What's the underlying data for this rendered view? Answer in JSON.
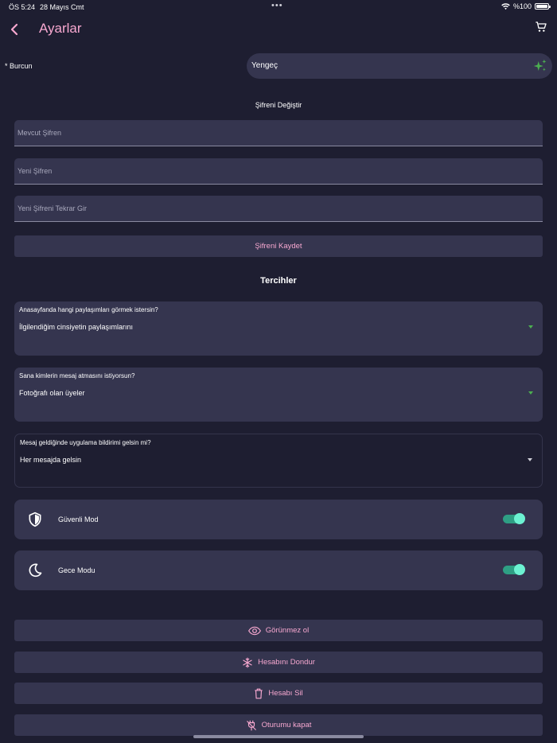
{
  "status_bar": {
    "time": "ÖS 5:24",
    "date": "28 Mayıs Cmt",
    "dots": "•••",
    "battery": "%100"
  },
  "header": {
    "title": "Ayarlar"
  },
  "zodiac": {
    "label": "* Burcun",
    "value": "Yengeç"
  },
  "password": {
    "section_title": "Şifreni Değiştir",
    "current_placeholder": "Mevcut Şifren",
    "new_placeholder": "Yeni Şifren",
    "repeat_placeholder": "Yeni Şifreni Tekrar Gir",
    "save_label": "Şifreni Kaydet"
  },
  "preferences": {
    "title": "Tercihler",
    "items": [
      {
        "question": "Anasayfanda hangi paylaşımları görmek istersin?",
        "value": "İlgilendiğim cinsiyetin paylaşımlarını"
      },
      {
        "question": "Sana kimlerin mesaj atmasını istiyorsun?",
        "value": "Fotoğrafı olan üyeler"
      },
      {
        "question": "Mesaj geldiğinde uygulama bildirimi gelsin mi?",
        "value": "Her mesajda gelsin"
      }
    ]
  },
  "toggles": [
    {
      "label": "Güvenli Mod",
      "icon": "shield-icon",
      "on": true
    },
    {
      "label": "Gece Modu",
      "icon": "moon-icon",
      "on": true
    }
  ],
  "actions": {
    "invisible": "Görünmez ol",
    "freeze": "Hesabını Dondur",
    "delete": "Hesabı Sil",
    "logout": "Oturumu kapat"
  },
  "colors": {
    "background": "#1e1e31",
    "card": "#35354f",
    "accent_pink": "#f7a8d0",
    "toggle_on": "#6cf2d2",
    "dropdown_green": "#4caf50"
  }
}
